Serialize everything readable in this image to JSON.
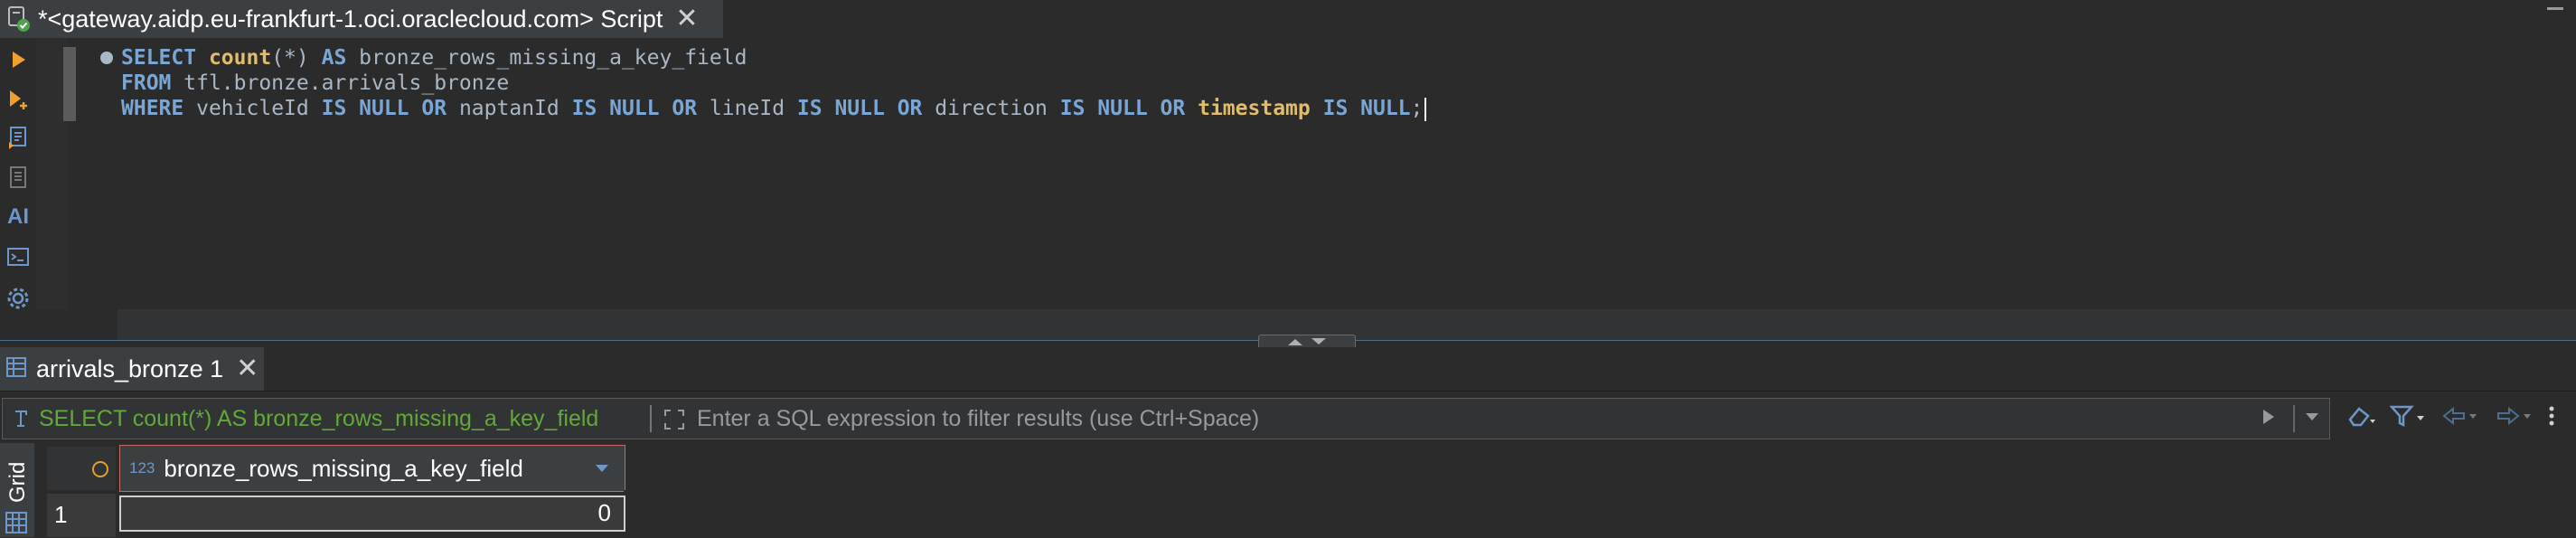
{
  "editor": {
    "tab_title": "*<gateway.aidp.eu-frankfurt-1.oci.oraclecloud.com> Script",
    "tab_close": "✕",
    "icons": [
      "execute-statement-icon",
      "execute-script-icon",
      "explain-plan-icon",
      "load-plan-icon",
      "ai-assistant-icon",
      "terminal-icon",
      "settings-icon"
    ],
    "ai_label": "AI",
    "code": {
      "line1": {
        "t0": "SELECT",
        "t1": "count",
        "t2": "(*)",
        "t3": "AS",
        "t4": "bronze_rows_missing_a_key_field"
      },
      "line2": {
        "t0": "FROM",
        "t1": "tfl.bronze.arrivals_bronze"
      },
      "line3": {
        "t0": "WHERE",
        "t1": "vehicleId",
        "t2": "IS NULL",
        "t3": "OR",
        "t4": "naptanId",
        "t5": "IS NULL",
        "t6": "OR",
        "t7": "lineId",
        "t8": "IS NULL",
        "t9": "OR",
        "t10": "direction",
        "t11": "IS NULL",
        "t12": "OR",
        "t13": "timestamp",
        "t14": "IS NULL",
        "t15": ";"
      }
    }
  },
  "results": {
    "tab_title": "arrivals_bronze 1",
    "tab_close": "✕",
    "filter": {
      "query_text": "SELECT count(*) AS bronze_rows_missing_a_key_field",
      "placeholder": "Enter a SQL expression to filter results (use Ctrl+Space)"
    },
    "grid": {
      "side_tab": "Grid",
      "column": {
        "type_badge": "123",
        "name": "bronze_rows_missing_a_key_field"
      },
      "rows": [
        {
          "num": "1",
          "value": "0"
        }
      ]
    }
  },
  "colors": {
    "background": "#2b2b2b",
    "keyword": "#7aa6d6",
    "function": "#e0bd6b",
    "filter_sql": "#62a83a",
    "run_icon": "#f0a030"
  }
}
